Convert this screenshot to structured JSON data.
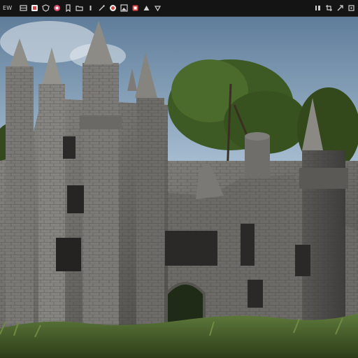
{
  "toolbar": {
    "brand_label": "EW",
    "buttons": [
      {
        "name": "grid-icon"
      },
      {
        "name": "image-icon"
      },
      {
        "name": "shield-icon"
      },
      {
        "name": "circle-badge-icon"
      },
      {
        "name": "bookmark-icon"
      },
      {
        "name": "folder-icon"
      },
      {
        "name": "info-icon"
      },
      {
        "name": "wand-icon"
      },
      {
        "name": "record-icon"
      },
      {
        "name": "gallery-icon"
      },
      {
        "name": "flag-icon"
      },
      {
        "name": "triangle-icon"
      },
      {
        "name": "gem-icon"
      }
    ],
    "right_buttons": [
      {
        "name": "columns-icon"
      },
      {
        "name": "crop-icon"
      },
      {
        "name": "share-icon"
      },
      {
        "name": "settings-icon"
      }
    ]
  },
  "canvas": {
    "image_name": "castle-render-image"
  },
  "colors": {
    "toolbar_bg": "#141414",
    "icon_fg": "#cfcfcf",
    "icon_red": "#e05050",
    "sky": "#a9bfd3"
  }
}
